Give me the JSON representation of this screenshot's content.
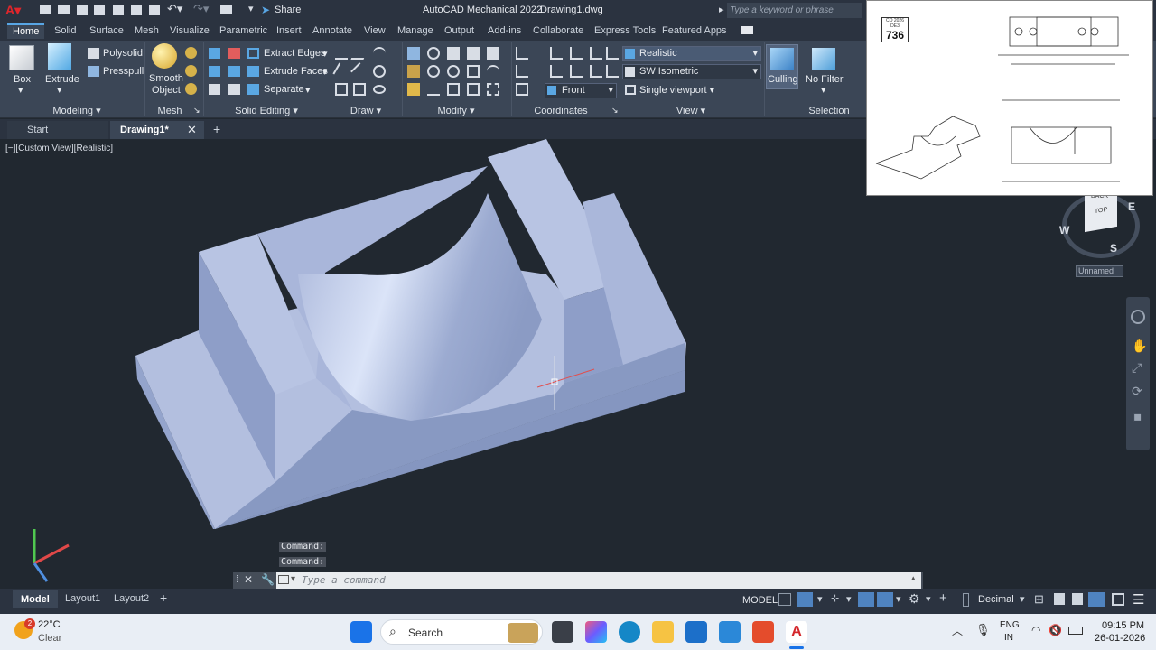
{
  "app": {
    "title": "AutoCAD Mechanical 2022",
    "filename": "Drawing1.dwg",
    "share": "Share",
    "search_placeholder": "Type a keyword or phrase"
  },
  "tabs": [
    "Home",
    "Solid",
    "Surface",
    "Mesh",
    "Visualize",
    "Parametric",
    "Insert",
    "Annotate",
    "View",
    "Manage",
    "Output",
    "Add-ins",
    "Collaborate",
    "Express Tools",
    "Featured Apps"
  ],
  "ribbon": {
    "modeling": {
      "box": "Box",
      "extrude": "Extrude",
      "polysolid": "Polysolid",
      "presspull": "Presspull",
      "title": "Modeling"
    },
    "mesh": {
      "smooth": "Smooth",
      "object": "Object",
      "title": "Mesh"
    },
    "solid_editing": {
      "extract": "Extract Edges",
      "extrude_faces": "Extrude Faces",
      "separate": "Separate",
      "title": "Solid Editing"
    },
    "draw": {
      "title": "Draw"
    },
    "modify": {
      "title": "Modify"
    },
    "coordinates": {
      "front": "Front",
      "title": "Coordinates"
    },
    "view": {
      "visual_style": "Realistic",
      "view_name": "SW Isometric",
      "viewport": "Single viewport",
      "title": "View"
    },
    "selection": {
      "culling": "Culling",
      "no_filter": "No Filter",
      "title": "Selection"
    }
  },
  "file_tabs": {
    "start": "Start",
    "drawing": "Drawing1*"
  },
  "viewport": {
    "label": "[−][Custom View][Realistic]",
    "cube_w": "W",
    "cube_e": "E",
    "cube_s": "S",
    "cube_top": "TOP",
    "cube_back": "BACK",
    "unnamed": "Unnamed"
  },
  "command": {
    "hist1": "Command:",
    "hist2": "Command:",
    "placeholder": "Type a command"
  },
  "layouts": [
    "Model",
    "Layout1",
    "Layout2"
  ],
  "status": {
    "model": "MODEL",
    "units": "Decimal"
  },
  "reference": {
    "number": "736",
    "tag": "CO 2026 DE3"
  },
  "taskbar": {
    "temp": "22°C",
    "weather": "Clear",
    "badge": "2",
    "search": "Search",
    "lang1": "ENG",
    "lang2": "IN",
    "time": "09:15 PM",
    "date": "26-01-2026"
  },
  "colors": {
    "accent": "#58a6e5",
    "ribbon": "#3b4656",
    "viewport": "#212830",
    "solid": "#9fb0d4"
  }
}
